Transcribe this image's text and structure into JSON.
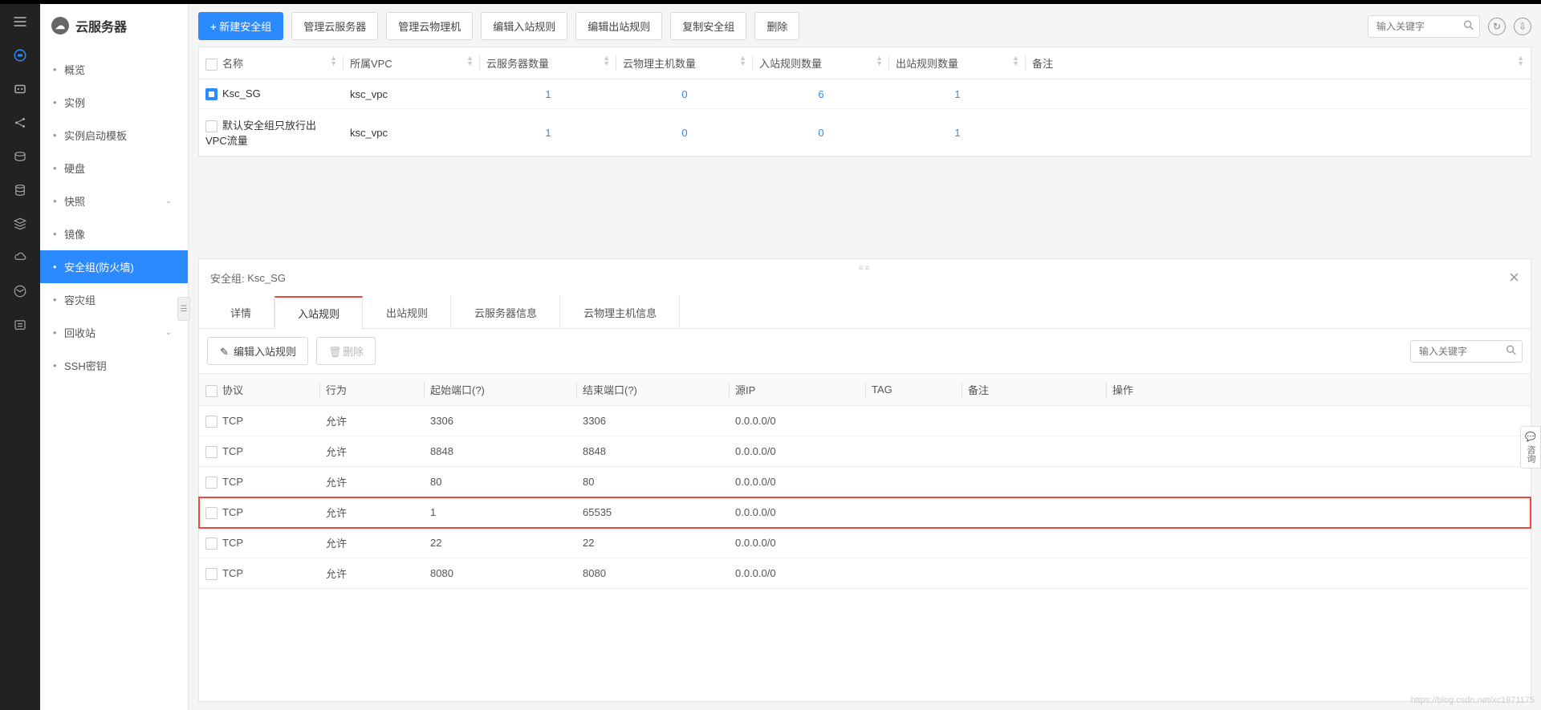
{
  "header": {
    "title": "云服务器"
  },
  "sidebar": {
    "items": [
      {
        "label": "概览"
      },
      {
        "label": "实例"
      },
      {
        "label": "实例启动模板"
      },
      {
        "label": "硬盘"
      },
      {
        "label": "快照",
        "chev": true
      },
      {
        "label": "镜像"
      },
      {
        "label": "安全组(防火墙)",
        "active": true
      },
      {
        "label": "容灾组"
      },
      {
        "label": "回收站",
        "chev": true
      },
      {
        "label": "SSH密钥"
      }
    ]
  },
  "toolbar": {
    "new_sg": "新建安全组",
    "manage_server": "管理云服务器",
    "manage_physical": "管理云物理机",
    "edit_in": "编辑入站规则",
    "edit_out": "编辑出站规则",
    "copy_sg": "复制安全组",
    "delete": "删除",
    "search_ph": "输入关键字"
  },
  "sg_table": {
    "headers": {
      "name": "名称",
      "vpc": "所属VPC",
      "server_cnt": "云服务器数量",
      "phys_cnt": "云物理主机数量",
      "in_cnt": "入站规则数量",
      "out_cnt": "出站规则数量",
      "remark": "备注"
    },
    "rows": [
      {
        "checked": true,
        "name": "Ksc_SG",
        "vpc": "ksc_vpc",
        "server": "1",
        "phys": "0",
        "in": "6",
        "out": "1",
        "remark": ""
      },
      {
        "checked": false,
        "name": "默认安全组只放行出VPC流量",
        "vpc": "ksc_vpc",
        "server": "1",
        "phys": "0",
        "in": "0",
        "out": "1",
        "remark": ""
      }
    ]
  },
  "detail": {
    "prefix": "安全组:",
    "name": "Ksc_SG",
    "tabs": {
      "detail": "详情",
      "in": "入站规则",
      "out": "出站规则",
      "server": "云服务器信息",
      "phys": "云物理主机信息"
    },
    "sub": {
      "edit": "编辑入站规则",
      "del": "删除",
      "search_ph": "输入关键字"
    },
    "rule_headers": {
      "proto": "协议",
      "action": "行为",
      "sport": "起始端口(?)",
      "eport": "结束端口(?)",
      "src": "源IP",
      "tag": "TAG",
      "remark": "备注",
      "op": "操作"
    },
    "rules": [
      {
        "proto": "TCP",
        "action": "允许",
        "sport": "3306",
        "eport": "3306",
        "src": "0.0.0.0/0"
      },
      {
        "proto": "TCP",
        "action": "允许",
        "sport": "8848",
        "eport": "8848",
        "src": "0.0.0.0/0"
      },
      {
        "proto": "TCP",
        "action": "允许",
        "sport": "80",
        "eport": "80",
        "src": "0.0.0.0/0"
      },
      {
        "proto": "TCP",
        "action": "允许",
        "sport": "1",
        "eport": "65535",
        "src": "0.0.0.0/0",
        "highlight": true
      },
      {
        "proto": "TCP",
        "action": "允许",
        "sport": "22",
        "eport": "22",
        "src": "0.0.0.0/0"
      },
      {
        "proto": "TCP",
        "action": "允许",
        "sport": "8080",
        "eport": "8080",
        "src": "0.0.0.0/0"
      }
    ]
  },
  "float": {
    "label": "咨询"
  },
  "watermark": "https://blog.csdn.net/xc1971175"
}
